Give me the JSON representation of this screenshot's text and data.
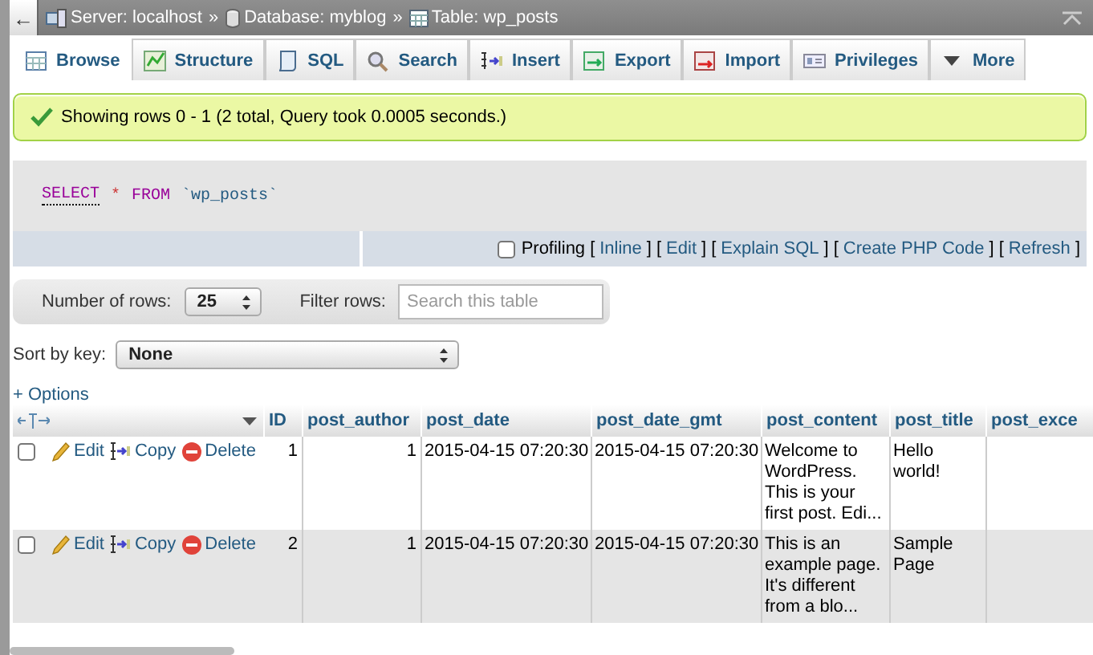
{
  "topbar": {
    "back_button": "←",
    "separator": "»",
    "breadcrumb": [
      {
        "kind": "server",
        "label": "Server: localhost"
      },
      {
        "kind": "database",
        "label": "Database: myblog"
      },
      {
        "kind": "table",
        "label": "Table: wp_posts"
      }
    ]
  },
  "tabs": [
    {
      "kind": "browse",
      "label": "Browse",
      "selected": true
    },
    {
      "kind": "structure",
      "label": "Structure",
      "selected": false
    },
    {
      "kind": "sql",
      "label": "SQL",
      "selected": false
    },
    {
      "kind": "search",
      "label": "Search",
      "selected": false
    },
    {
      "kind": "insert",
      "label": "Insert",
      "selected": false
    },
    {
      "kind": "export",
      "label": "Export",
      "selected": false
    },
    {
      "kind": "import",
      "label": "Import",
      "selected": false
    },
    {
      "kind": "privileges",
      "label": "Privileges",
      "selected": false
    },
    {
      "kind": "more",
      "label": "More",
      "selected": false
    }
  ],
  "message": "Showing rows 0 - 1 (2 total, Query took 0.0005 seconds.)",
  "sql": {
    "tokens": [
      {
        "kind": "keyword",
        "text": "SELECT"
      },
      {
        "kind": "operator",
        "text": "*"
      },
      {
        "kind": "keyword",
        "text": "FROM"
      },
      {
        "kind": "identifier",
        "text": "`wp_posts`"
      }
    ],
    "profiling": {
      "label": "Profiling",
      "checked": false
    },
    "bracket_open": "[",
    "bracket_close": "]",
    "links": [
      "Inline",
      "Edit",
      "Explain SQL",
      "Create PHP Code",
      "Refresh"
    ]
  },
  "navigation": {
    "rows_label": "Number of rows:",
    "rows_value": "25",
    "filter_label": "Filter rows:",
    "filter_placeholder": "Search this table"
  },
  "sort": {
    "label": "Sort by key:",
    "value": "None"
  },
  "options": "+ Options",
  "table": {
    "columns": [
      "ID",
      "post_author",
      "post_date",
      "post_date_gmt",
      "post_content",
      "post_title",
      "post_exce"
    ],
    "rows": [
      {
        "checked": false,
        "actions": [
          "Edit",
          "Copy",
          "Delete"
        ],
        "cells": [
          "1",
          "1",
          "2015-04-15 07:20:30",
          "2015-04-15 07:20:30",
          "Welcome to WordPress. This is your first post. Edi...",
          "Hello world!",
          ""
        ]
      },
      {
        "checked": false,
        "actions": [
          "Edit",
          "Copy",
          "Delete"
        ],
        "cells": [
          "2",
          "1",
          "2015-04-15 07:20:30",
          "2015-04-15 07:20:30",
          "This is an example page. It's different from a blo...",
          "Sample Page",
          ""
        ]
      }
    ]
  }
}
